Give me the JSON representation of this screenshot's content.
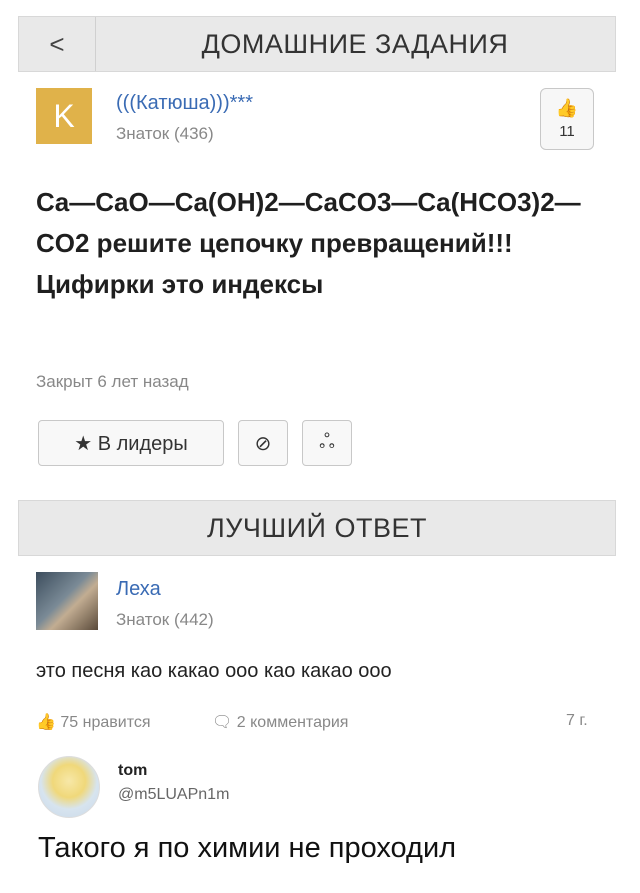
{
  "header": {
    "back_icon": "chevron-left-icon",
    "back_glyph": "<",
    "title": "ДОМАШНИЕ ЗАДАНИЯ"
  },
  "question": {
    "author_initial": "K",
    "author_color": "#e0b24a",
    "author_name": "(((Катюша)))***",
    "author_rank": "Знаток (436)",
    "likes": "11",
    "text": "Ca—CaO—Ca(OH)2—CaCO3—Ca(HCO3)2—CO2 решите цепочку превращений!!! Цифирки это индексы",
    "status": "Закрыт 6 лет назад"
  },
  "actions": {
    "leaders_label": "★ В лидеры",
    "block_glyph": "⊘",
    "share_glyph": "ஃ"
  },
  "best_answer": {
    "title": "ЛУЧШИЙ ОТВЕТ",
    "author_name": "Леха",
    "author_rank": "Знаток (442)",
    "text": "это песня као какао ооо као какао ооо",
    "likes_label": "75 нравится",
    "comments_label": "2 комментария",
    "time": "7 г."
  },
  "tweet": {
    "name": "tom",
    "handle": "@m5LUAPn1m",
    "text": "Такого я по химии не проходил"
  }
}
